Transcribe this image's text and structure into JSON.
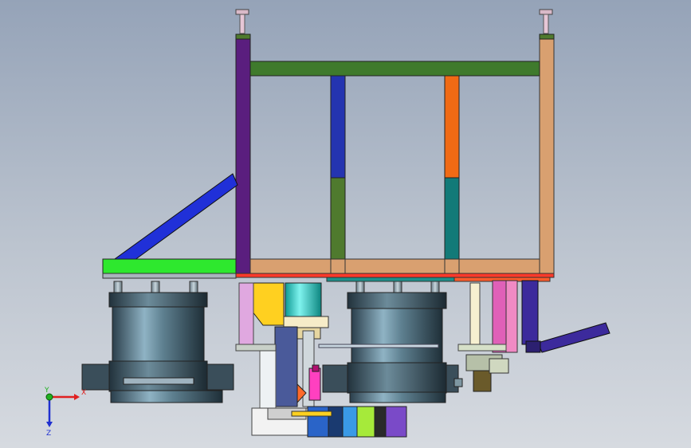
{
  "viewport": {
    "background_top": "#95a3b8",
    "background_bottom": "#d6dae0"
  },
  "triad": {
    "x_label": "X",
    "y_label": "Y",
    "z_label": "Z",
    "x_color": "#e02020",
    "y_color": "#20b020",
    "z_color": "#2030d0"
  },
  "parts": {
    "left_column": "#5a1e7e",
    "right_column": "#d9a070",
    "top_beam": "#3f7a2c",
    "inner_post_1_upper": "#2434b0",
    "inner_post_1_lower": "#4f7a2e",
    "inner_post_2_upper": "#f06a14",
    "inner_post_2_lower": "#127a78",
    "base_beam": "#d9a070",
    "diagonal_brace": "#2030d8",
    "left_platform": "#2ee82e",
    "cylinder_body": "#3d5868",
    "cyan_motor": "#20d8d0",
    "yellow_bracket": "#ffd020",
    "right_arm": "#3c2a9c"
  }
}
